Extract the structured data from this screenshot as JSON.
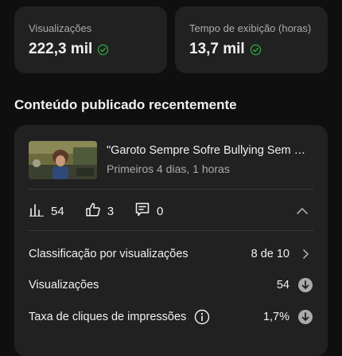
{
  "stats": [
    {
      "label": "Visualizações",
      "value": "222,3 mil",
      "icon": "check-circle-icon"
    },
    {
      "label": "Tempo de exibição (horas)",
      "value": "13,7 mil",
      "icon": "check-circle-icon"
    }
  ],
  "section": {
    "title": "Conteúdo publicado recentemente"
  },
  "video": {
    "title": "\"Garoto Sempre Sofre Bullying Sem Motivo\"",
    "subtitle": "Primeiros 4 dias, 1 horas"
  },
  "metrics": {
    "views": "54",
    "likes": "3",
    "comments": "0"
  },
  "rows": [
    {
      "label": "Classificação por visualizações",
      "value": "8 de 10",
      "trail": "chevron-right-icon"
    },
    {
      "label": "Visualizações",
      "value": "54",
      "trail": "arrow-down-circle-icon"
    },
    {
      "label": "Taxa de cliques de impressões",
      "value": "1,7%",
      "trail": "arrow-down-circle-icon",
      "info": "info-icon"
    }
  ],
  "colors": {
    "background": "#0f0f0f",
    "card": "#212121",
    "muted": "#aaaaaa",
    "check": "#2ba640"
  }
}
